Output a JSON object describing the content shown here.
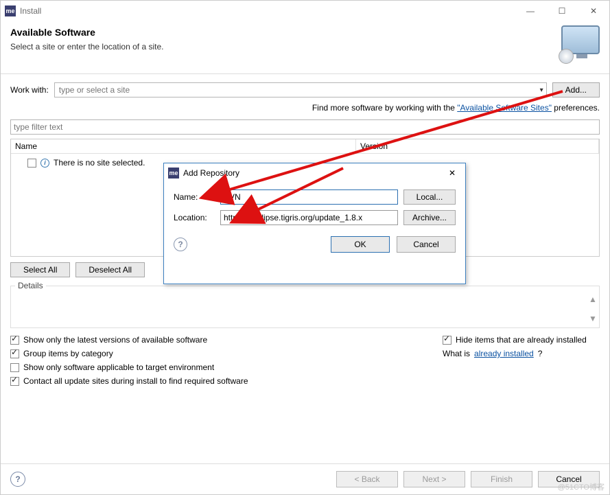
{
  "titlebar": {
    "title": "Install"
  },
  "banner": {
    "heading": "Available Software",
    "subtitle": "Select a site or enter the location of a site."
  },
  "workwith": {
    "label": "Work with:",
    "placeholder": "type or select a site",
    "add_btn": "Add..."
  },
  "hint": {
    "prefix": "Find more software by working with the ",
    "link": "\"Available Software Sites\"",
    "suffix": " preferences."
  },
  "filter": {
    "placeholder": "type filter text"
  },
  "table": {
    "col_name": "Name",
    "col_version": "Version",
    "empty_row": "There is no site selected."
  },
  "select_all": "Select All",
  "deselect_all": "Deselect All",
  "details": {
    "legend": "Details"
  },
  "options": {
    "latest": "Show only the latest versions of available software",
    "group": "Group items by category",
    "applicable": "Show only software applicable to target environment",
    "contact": "Contact all update sites during install to find required software",
    "hide": "Hide items that are already installed",
    "whatis_prefix": "What is ",
    "whatis_link": "already installed",
    "whatis_suffix": "?"
  },
  "footer": {
    "back": "< Back",
    "next": "Next >",
    "finish": "Finish",
    "cancel": "Cancel"
  },
  "modal": {
    "title": "Add Repository",
    "name_label": "Name:",
    "name_value": "SVN",
    "loc_label": "Location:",
    "loc_value": "http://subclipse.tigris.org/update_1.8.x",
    "local_btn": "Local...",
    "archive_btn": "Archive...",
    "ok": "OK",
    "cancel": "Cancel"
  },
  "watermark": "@51CTO博客"
}
